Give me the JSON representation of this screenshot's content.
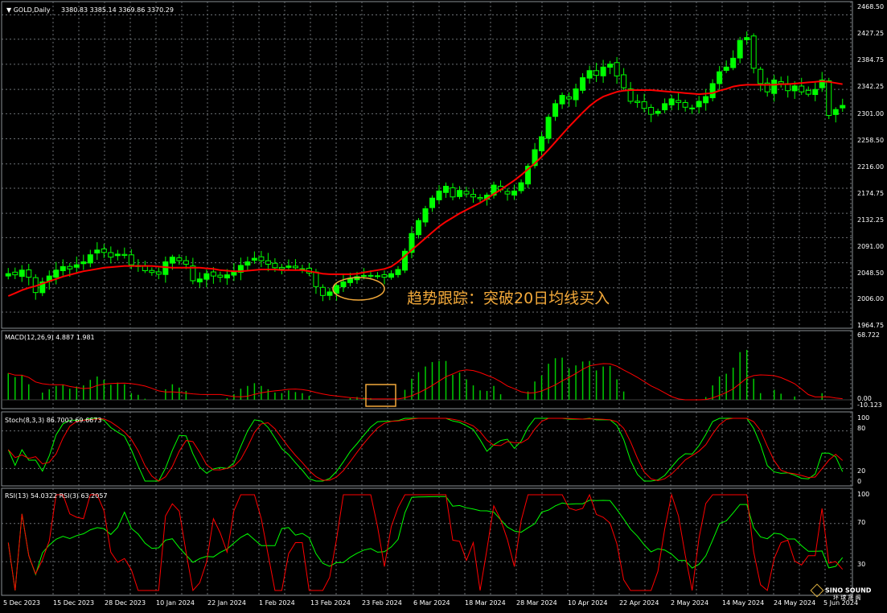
{
  "header": {
    "symbol": "GOLD,Daily",
    "ohlc": "3380.83 3385.14 3369.86 3370.29"
  },
  "annotation": "趋势跟踪：突破20日均线买入",
  "logo": {
    "text": "SINO SOUND",
    "sub": "环 球 晟 阁"
  },
  "colors": {
    "background": "#000000",
    "grid": "#6b7075",
    "candle": "#00ff00",
    "candle_down_body": "#000000",
    "ma20": "#ff0000",
    "macd_hist": "#00cc00",
    "macd_signal": "#ff0000",
    "stoch_main": "#00ff00",
    "stoch_signal": "#ff0000",
    "rsi_slow": "#00ff00",
    "rsi_fast": "#ff0000",
    "highlight": "#f3a93a"
  },
  "chart_data": [
    {
      "type": "candlestick",
      "title": "GOLD,Daily",
      "ylim": [
        1943,
        2480
      ],
      "y_ticks": [
        "2468.50",
        "2427.25",
        "2384.75",
        "2342.25",
        "2301.00",
        "2258.50",
        "2216.00",
        "2174.75",
        "2132.25",
        "2091.00",
        "2048.50",
        "2006.00",
        "1964.75"
      ],
      "x_ticks": [
        "5 Dec 2023",
        "15 Dec 2023",
        "28 Dec 2023",
        "10 Jan 2024",
        "22 Jan 2024",
        "1 Feb 2024",
        "13 Feb 2024",
        "23 Feb 2024",
        "6 Mar 2024",
        "18 Mar 2024",
        "28 Mar 2024",
        "10 Apr 2024",
        "22 Apr 2024",
        "2 May 2024",
        "14 May 2024",
        "24 May 2024",
        "5 Jun 2024"
      ],
      "close": [
        2030,
        2028,
        2036,
        2024,
        1998,
        2016,
        2026,
        2036,
        2042,
        2038,
        2045,
        2050,
        2062,
        2070,
        2066,
        2058,
        2063,
        2061,
        2045,
        2042,
        2035,
        2032,
        2029,
        2050,
        2058,
        2052,
        2046,
        2018,
        2021,
        2030,
        2026,
        2024,
        2028,
        2034,
        2044,
        2050,
        2056,
        2052,
        2046,
        2040,
        2038,
        2043,
        2040,
        2038,
        2031,
        2008,
        1993,
        1999,
        2010,
        2016,
        2022,
        2025,
        2026,
        2027,
        2026,
        2024,
        2030,
        2037,
        2068,
        2098,
        2120,
        2140,
        2158,
        2170,
        2178,
        2160,
        2171,
        2165,
        2160,
        2157,
        2163,
        2180,
        2172,
        2165,
        2170,
        2184,
        2212,
        2240,
        2262,
        2295,
        2318,
        2332,
        2326,
        2343,
        2362,
        2374,
        2366,
        2380,
        2385,
        2365,
        2345,
        2322,
        2320,
        2310,
        2300,
        2305,
        2318,
        2326,
        2320,
        2312,
        2310,
        2322,
        2330,
        2352,
        2372,
        2380,
        2395,
        2425,
        2430,
        2378,
        2352,
        2338,
        2358,
        2352,
        2340,
        2348,
        2338,
        2334,
        2342,
        2358,
        2298,
        2308,
        2315
      ],
      "ma20": [
        1992,
        1997,
        2002,
        2006,
        2009,
        2013,
        2017,
        2021,
        2025,
        2028,
        2031,
        2034,
        2036,
        2038,
        2040,
        2041,
        2042,
        2043,
        2043,
        2043,
        2043,
        2043,
        2042,
        2041,
        2040,
        2040,
        2040,
        2040,
        2040,
        2039,
        2038,
        2036,
        2035,
        2034,
        2034,
        2035,
        2036,
        2037,
        2037,
        2037,
        2036,
        2036,
        2036,
        2036,
        2034,
        2032,
        2030,
        2029,
        2029,
        2029,
        2029,
        2030,
        2032,
        2034,
        2036,
        2038,
        2042,
        2050,
        2060,
        2070,
        2080,
        2090,
        2100,
        2110,
        2118,
        2125,
        2132,
        2138,
        2144,
        2150,
        2157,
        2165,
        2172,
        2180,
        2188,
        2197,
        2207,
        2217,
        2228,
        2240,
        2253,
        2266,
        2279,
        2291,
        2303,
        2314,
        2323,
        2330,
        2334,
        2338,
        2340,
        2341,
        2341,
        2341,
        2341,
        2340,
        2339,
        2338,
        2337,
        2336,
        2335,
        2334,
        2335,
        2336,
        2340,
        2343,
        2347,
        2349,
        2350,
        2350,
        2350,
        2350,
        2350,
        2351,
        2351,
        2352,
        2353,
        2354,
        2355,
        2356,
        2355,
        2353,
        2351
      ]
    },
    {
      "type": "bar",
      "title": "MACD(12,26,9) 4.887 1.981",
      "ylim": [
        -10.123,
        68.722
      ],
      "y_ticks": [
        "68.722",
        "0.00",
        "-10.123"
      ],
      "series": [
        {
          "name": "MACD"
        },
        {
          "name": "Signal"
        }
      ]
    },
    {
      "type": "line",
      "title": "Stoch(8,3,3) 86.7002 69.6673",
      "ylim": [
        0,
        100
      ],
      "y_ticks": [
        "100",
        "80",
        "20",
        "0"
      ],
      "series": [
        {
          "name": "Main"
        },
        {
          "name": "Signal"
        }
      ]
    },
    {
      "type": "line",
      "title": "RSI(13) 54.0322  RSI(3) 63.2057",
      "ylim": [
        0,
        100
      ],
      "y_ticks": [
        "100",
        "70",
        "30"
      ],
      "series": [
        {
          "name": "RSI(13)"
        },
        {
          "name": "RSI(3)"
        }
      ]
    }
  ]
}
